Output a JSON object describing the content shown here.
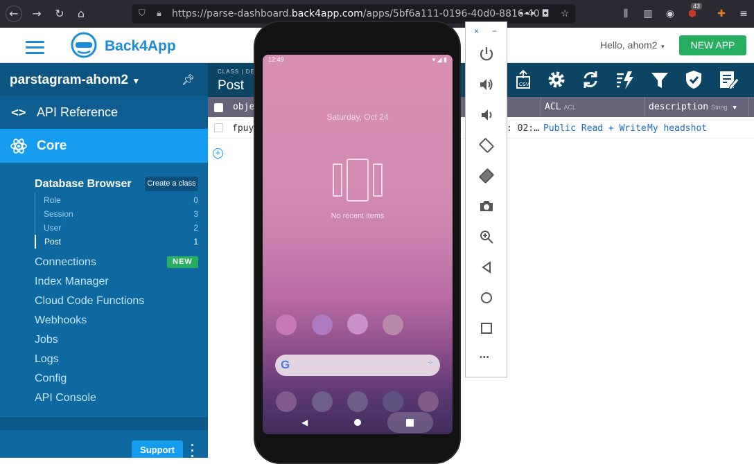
{
  "browser": {
    "url_prefix": "https://parse-dashboard.",
    "url_host": "back4app.com",
    "url_suffix": "/apps/5bf6a111-0196-40d0-8816-40",
    "notification_count": "43"
  },
  "header": {
    "brand": "Back4App",
    "greeting": "Hello, ahom2",
    "new_app_label": "NEW APP"
  },
  "sidebar": {
    "app_name": "parstagram-ahom2",
    "api_reference": "API Reference",
    "core": "Core",
    "database_browser": "Database Browser",
    "create_class": "Create a class",
    "classes": [
      {
        "name": "Role",
        "count": "0"
      },
      {
        "name": "Session",
        "count": "3"
      },
      {
        "name": "User",
        "count": "2"
      },
      {
        "name": "Post",
        "count": "1"
      }
    ],
    "links": [
      "Connections",
      "Index Manager",
      "Cloud Code Functions",
      "Webhooks",
      "Jobs",
      "Logs",
      "Config",
      "API Console"
    ],
    "new_badge": "NEW",
    "support": "Support"
  },
  "toolbar": {
    "class_label": "CLASS | DE",
    "class_name": "Post"
  },
  "table": {
    "col_object": "obje",
    "col_acl": "ACL",
    "col_acl_type": "ACL",
    "col_description": "description",
    "col_description_type": "String",
    "row": {
      "object_id": "fpuy",
      "date_fragment": ": 02:…",
      "acl": "Public Read + Write",
      "description": "My headshot"
    }
  },
  "phone": {
    "time": "12:49",
    "date": "Saturday, Oct 24",
    "no_recent": "No recent items"
  },
  "emulator": {
    "close": "×",
    "minimize": "−",
    "more": "•••"
  },
  "colors": {
    "brand_blue": "#169cee",
    "sidebar_bg": "#0e69a1",
    "new_green": "#27ae60",
    "toolbar_bg": "#0c4464"
  }
}
